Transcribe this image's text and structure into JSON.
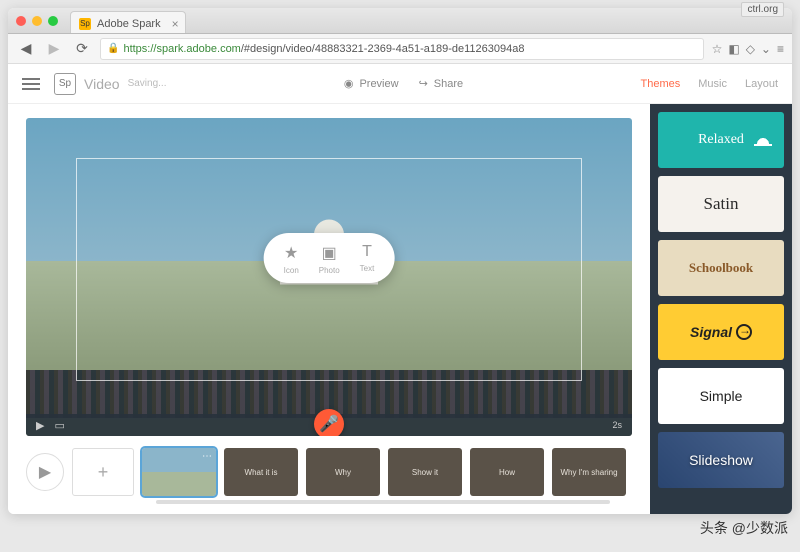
{
  "browser": {
    "tab_title": "Adobe Spark",
    "url_host": "https://spark.adobe.com",
    "url_path": "/#design/video/48883321-2369-4a51-a189-de11263094a8",
    "keyboard_hint": "ctrl.org"
  },
  "header": {
    "logo": "Sp",
    "title": "Video",
    "status": "Saving...",
    "preview": "Preview",
    "share": "Share",
    "tabs": {
      "themes": "Themes",
      "music": "Music",
      "layout": "Layout"
    }
  },
  "popup": {
    "icon": "Icon",
    "photo": "Photo",
    "text": "Text"
  },
  "player": {
    "duration": "2s"
  },
  "timeline": {
    "slides": [
      {
        "label": "",
        "type": "thumb"
      },
      {
        "label": "What it is",
        "type": "text"
      },
      {
        "label": "Why",
        "type": "text"
      },
      {
        "label": "Show it",
        "type": "text"
      },
      {
        "label": "How",
        "type": "text"
      },
      {
        "label": "Why I'm sharing",
        "type": "text"
      }
    ]
  },
  "themes": {
    "relaxed": "Relaxed",
    "satin": "Satin",
    "schoolbook": "Schoolbook",
    "signal": "Signal",
    "simple": "Simple",
    "slideshow": "Slideshow"
  },
  "watermark": "头条 @少数派"
}
